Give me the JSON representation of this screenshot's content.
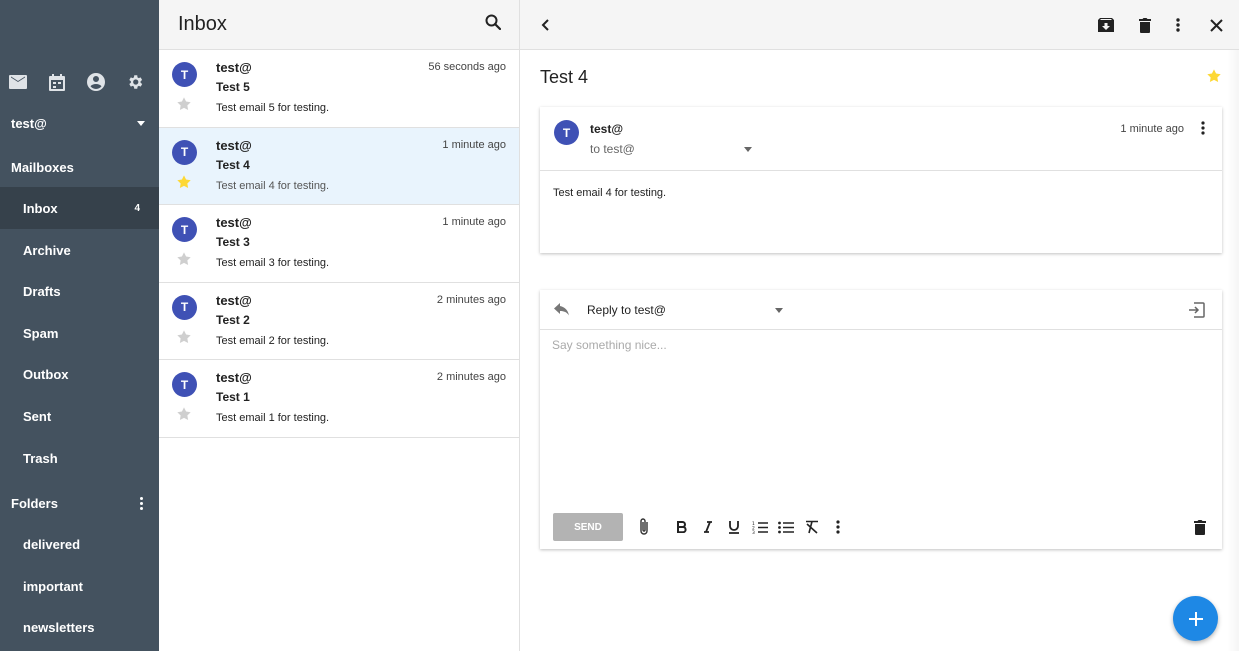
{
  "sidebar": {
    "account": "test@",
    "mailboxes_heading": "Mailboxes",
    "mailboxes": [
      {
        "label": "Inbox",
        "badge": "4"
      },
      {
        "label": "Archive"
      },
      {
        "label": "Drafts"
      },
      {
        "label": "Spam"
      },
      {
        "label": "Outbox"
      },
      {
        "label": "Sent"
      },
      {
        "label": "Trash"
      }
    ],
    "folders_heading": "Folders",
    "folders": [
      {
        "label": "delivered"
      },
      {
        "label": "important"
      },
      {
        "label": "newsletters"
      }
    ],
    "icons": [
      "mail-icon",
      "calendar-icon",
      "account-icon",
      "settings-icon"
    ]
  },
  "list": {
    "title": "Inbox",
    "messages": [
      {
        "from": "test@",
        "time": "56 seconds ago",
        "subject": "Test 5",
        "snippet": "Test email 5 for testing.",
        "avatar": "T",
        "starred": false
      },
      {
        "from": "test@",
        "time": "1 minute ago",
        "subject": "Test 4",
        "snippet": "Test email 4 for testing.",
        "avatar": "T",
        "starred": true
      },
      {
        "from": "test@",
        "time": "1 minute ago",
        "subject": "Test 3",
        "snippet": "Test email 3 for testing.",
        "avatar": "T",
        "starred": false
      },
      {
        "from": "test@",
        "time": "2 minutes ago",
        "subject": "Test 2",
        "snippet": "Test email 2 for testing.",
        "avatar": "T",
        "starred": false
      },
      {
        "from": "test@",
        "time": "2 minutes ago",
        "subject": "Test 1",
        "snippet": "Test email 1 for testing.",
        "avatar": "T",
        "starred": false
      }
    ]
  },
  "reader": {
    "subject": "Test 4",
    "email": {
      "avatar": "T",
      "from": "test@",
      "to": "to test@",
      "time": "1 minute ago",
      "body": "Test email 4 for testing."
    },
    "reply": {
      "to": "Reply to test@",
      "placeholder": "Say something nice...",
      "send_label": "SEND"
    }
  },
  "colors": {
    "sidebar_bg": "#44525f",
    "sidebar_active": "#36414b",
    "avatar": "#3f51b5",
    "star_on": "#fdd835",
    "star_off": "#cfcfcf",
    "fab": "#1e88e5",
    "selected_row": "#e9f4fd"
  }
}
